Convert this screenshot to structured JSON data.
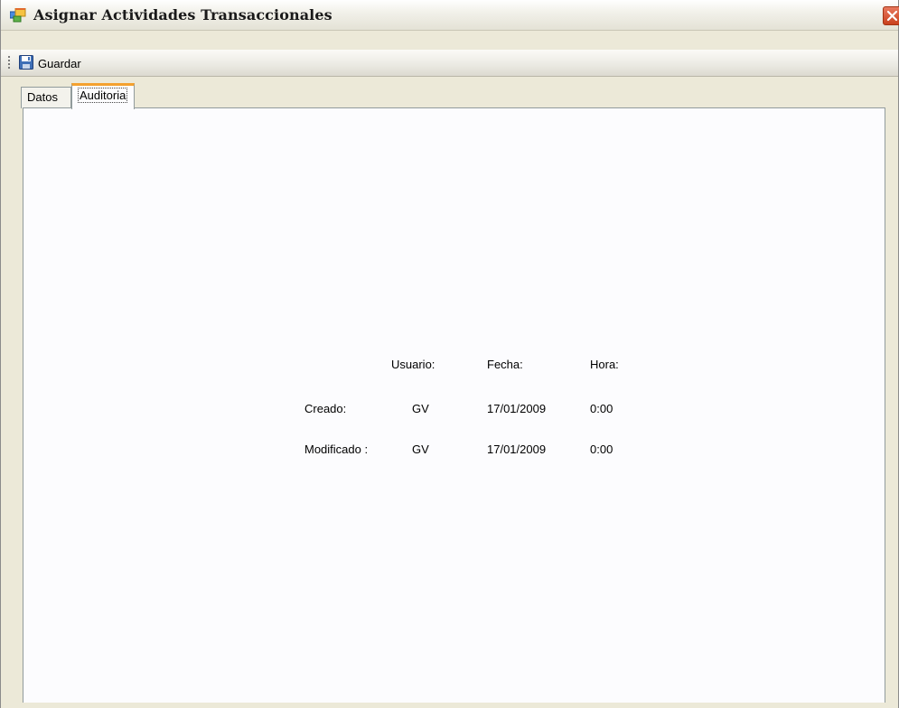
{
  "window": {
    "title": "Asignar Actividades Transaccionales"
  },
  "toolbar": {
    "save_label": "Guardar"
  },
  "tabs": [
    {
      "label": "Datos",
      "active": false
    },
    {
      "label": "Auditoria",
      "active": true
    }
  ],
  "audit": {
    "headers": {
      "user": "Usuario:",
      "date": "Fecha:",
      "time": "Hora:"
    },
    "rows": [
      {
        "label": "Creado:",
        "user": "GV",
        "date": "17/01/2009",
        "time": "0:00"
      },
      {
        "label": "Modificado :",
        "user": "GV",
        "date": "17/01/2009",
        "time": "0:00"
      }
    ]
  },
  "icons": {
    "app": "form-window-icon",
    "close": "close-icon",
    "save": "floppy-disk-icon",
    "grip": "toolbar-grip-icon"
  },
  "colors": {
    "close_button": "#c9401d",
    "active_tab_accent": "#f4a12f",
    "panel_background": "#fcfcfe",
    "chrome_background": "#ece9d8"
  }
}
